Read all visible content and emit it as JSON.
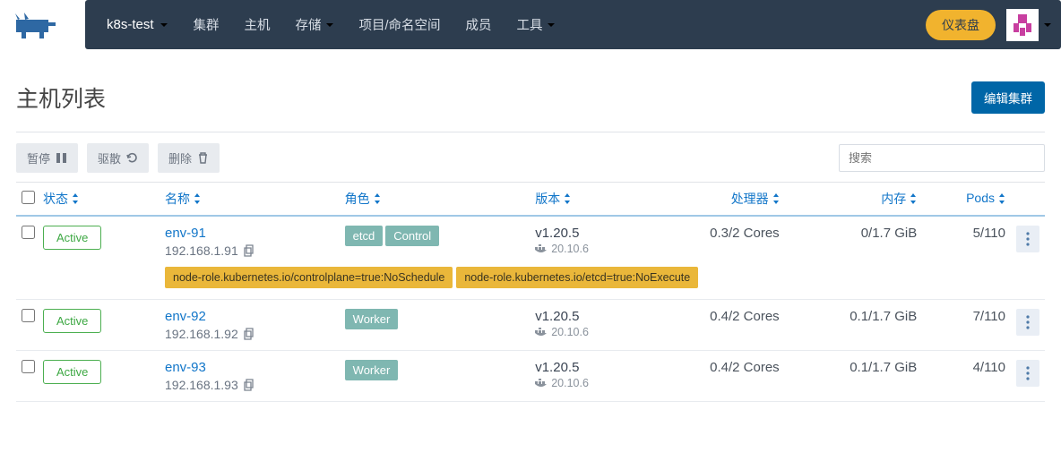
{
  "header": {
    "cluster": "k8s-test",
    "nav": [
      "集群",
      "主机",
      "存储",
      "项目/命名空间",
      "成员",
      "工具"
    ],
    "nav_has_chev": [
      false,
      false,
      true,
      false,
      false,
      true
    ],
    "dashboard": "仪表盘"
  },
  "page": {
    "title": "主机列表",
    "edit_cluster": "编辑集群"
  },
  "actions": {
    "pause": "暂停",
    "drain": "驱散",
    "delete": "删除"
  },
  "search": {
    "placeholder": "搜索"
  },
  "columns": {
    "state": "状态",
    "name": "名称",
    "roles": "角色",
    "version": "版本",
    "cpu": "处理器",
    "memory": "内存",
    "pods": "Pods"
  },
  "nodes": [
    {
      "state": "Active",
      "name": "env-91",
      "ip": "192.168.1.91",
      "roles": [
        "etcd",
        "Control"
      ],
      "k8s": "v1.20.5",
      "docker": "20.10.6",
      "cpu": "0.3/2 Cores",
      "mem": "0/1.7 GiB",
      "pods": "5/110",
      "taints": [
        "node-role.kubernetes.io/controlplane=true:NoSchedule",
        "node-role.kubernetes.io/etcd=true:NoExecute"
      ]
    },
    {
      "state": "Active",
      "name": "env-92",
      "ip": "192.168.1.92",
      "roles": [
        "Worker"
      ],
      "k8s": "v1.20.5",
      "docker": "20.10.6",
      "cpu": "0.4/2 Cores",
      "mem": "0.1/1.7 GiB",
      "pods": "7/110",
      "taints": []
    },
    {
      "state": "Active",
      "name": "env-93",
      "ip": "192.168.1.93",
      "roles": [
        "Worker"
      ],
      "k8s": "v1.20.5",
      "docker": "20.10.6",
      "cpu": "0.4/2 Cores",
      "mem": "0.1/1.7 GiB",
      "pods": "4/110",
      "taints": []
    }
  ]
}
